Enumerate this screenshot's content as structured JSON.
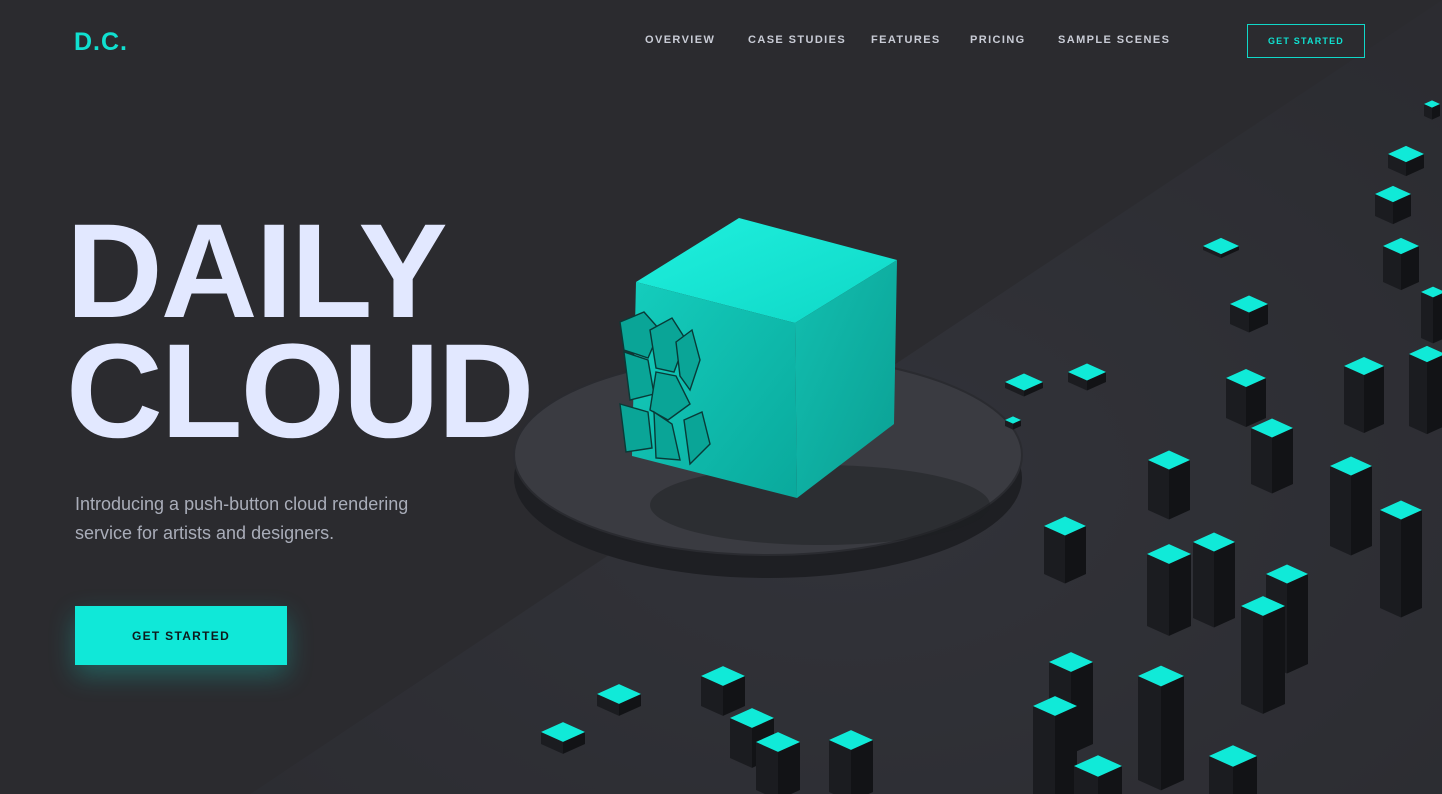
{
  "brand": {
    "logo": "D.C."
  },
  "nav": {
    "items": [
      {
        "label": "OVERVIEW",
        "name": "nav-overview"
      },
      {
        "label": "CASE STUDIES",
        "name": "nav-case-studies"
      },
      {
        "label": "FEATURES",
        "name": "nav-features"
      },
      {
        "label": "PRICING",
        "name": "nav-pricing"
      },
      {
        "label": "SAMPLE SCENES",
        "name": "nav-sample-scenes"
      }
    ],
    "cta_label": "GET STARTED"
  },
  "hero": {
    "title_line1": "DAILY",
    "title_line2": "CLOUD",
    "subtitle": "Introducing a push-button cloud rendering service for artists and designers.",
    "cta_label": "GET STARTED"
  },
  "colors": {
    "accent": "#10e8d8",
    "background": "#2b2b2f",
    "heading": "#e2e8ff"
  }
}
